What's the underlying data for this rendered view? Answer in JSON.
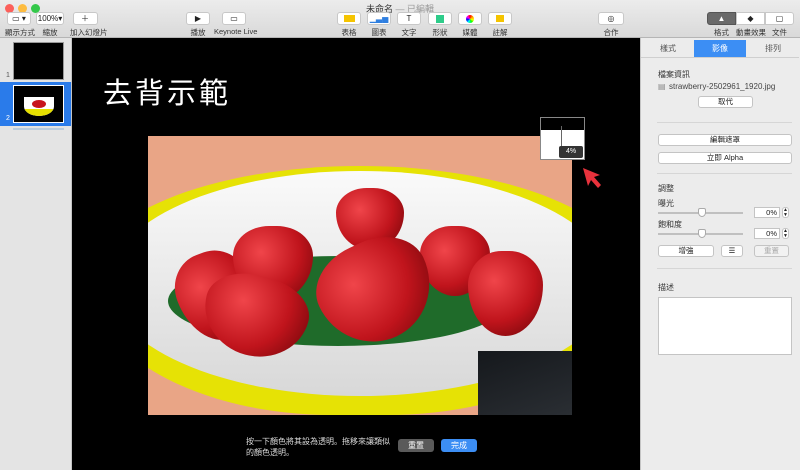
{
  "window": {
    "title": "未命名",
    "status": "— 已編輯"
  },
  "toolbar": {
    "left": [
      {
        "id": "view",
        "label": "顯示方式",
        "icon": "sidebar-icon"
      },
      {
        "id": "zoom",
        "label": "縮放",
        "value": "100%"
      },
      {
        "id": "add-slide",
        "label": "加入幻燈片",
        "icon": "plus-icon"
      }
    ],
    "center": [
      {
        "id": "play",
        "label": "播放",
        "icon": "play-icon"
      },
      {
        "id": "keynote-live",
        "label": "Keynote Live",
        "icon": "keynote-live-icon"
      }
    ],
    "insert": [
      {
        "id": "table",
        "label": "表格",
        "icon": "table-icon"
      },
      {
        "id": "chart",
        "label": "圖表",
        "icon": "chart-icon"
      },
      {
        "id": "text",
        "label": "文字",
        "icon": "text-icon"
      },
      {
        "id": "shape",
        "label": "形狀",
        "icon": "shape-icon"
      },
      {
        "id": "media",
        "label": "媒體",
        "icon": "media-icon"
      },
      {
        "id": "comment",
        "label": "註解",
        "icon": "comment-icon"
      }
    ],
    "collaborate": {
      "label": "合作",
      "icon": "collaborate-icon"
    },
    "right": [
      {
        "id": "format",
        "label": "格式",
        "icon": "format-brush-icon",
        "active": true
      },
      {
        "id": "animate",
        "label": "動畫效果",
        "icon": "animate-icon"
      },
      {
        "id": "document",
        "label": "文件",
        "icon": "document-icon"
      }
    ]
  },
  "slides": [
    {
      "number": "1"
    },
    {
      "number": "2",
      "selected": true
    }
  ],
  "slide": {
    "title": "去背示範",
    "loupe_value": "4%"
  },
  "instant_alpha": {
    "hint": "按一下顏色將其設為透明。拖移來讓類似的顏色透明。",
    "reset_label": "重置",
    "done_label": "完成"
  },
  "inspector": {
    "tabs": [
      "樣式",
      "影像",
      "排列"
    ],
    "selected_tab": "影像",
    "file_info_label": "檔案資訊",
    "filename": "strawberry-2502961_1920.jpg",
    "replace_label": "取代",
    "edit_mask_label": "編輯遮罩",
    "instant_alpha_label": "立即 Alpha",
    "adjust_label": "調整",
    "exposure_label": "曝光",
    "exposure_value": "0%",
    "saturation_label": "飽和度",
    "saturation_value": "0%",
    "enhance_label": "增強",
    "reset_label": "重置",
    "description_label": "描述",
    "description_value": ""
  },
  "colors": {
    "accent": "#3c8ef4",
    "arrow": "#e8323c"
  }
}
